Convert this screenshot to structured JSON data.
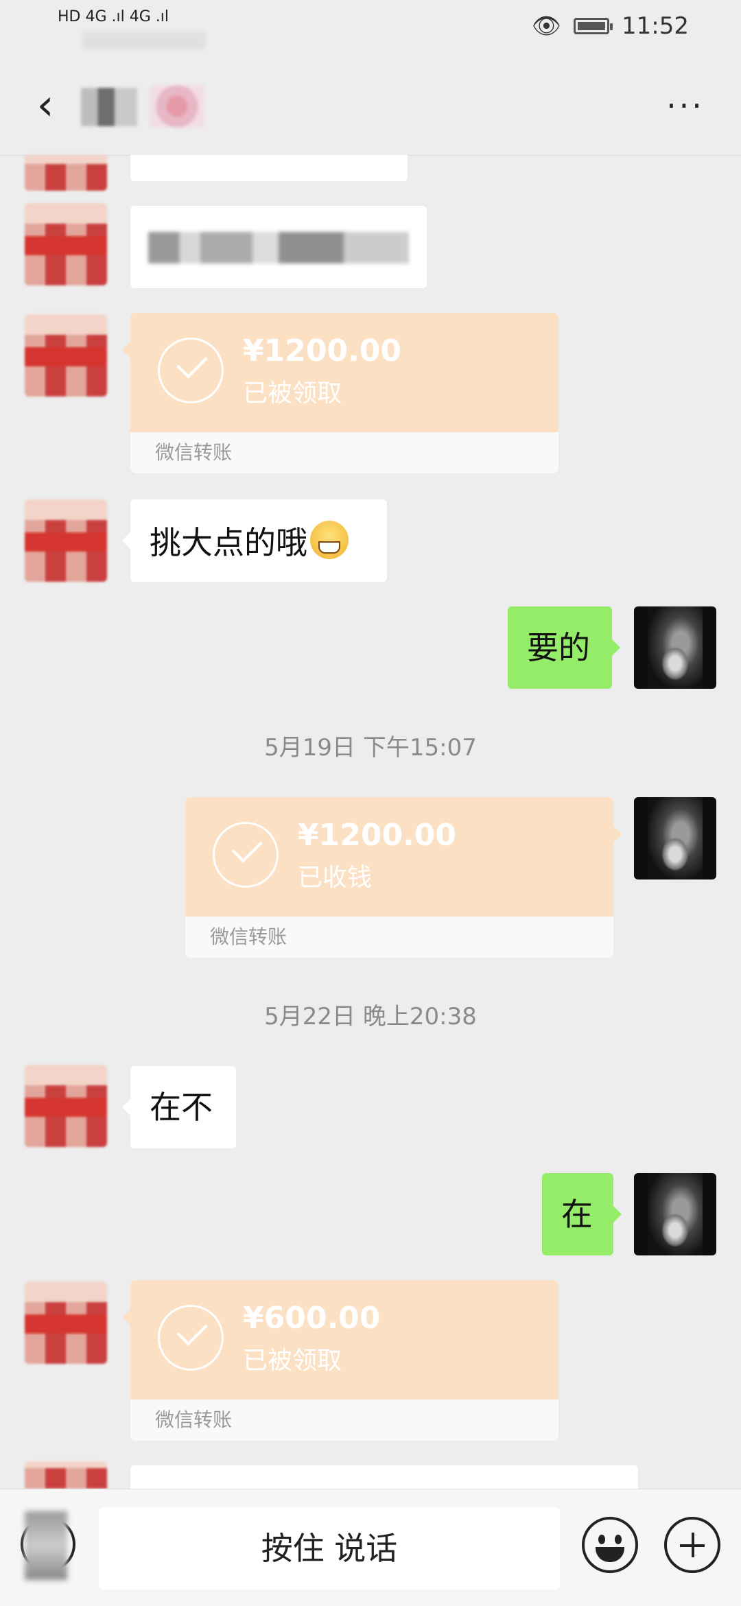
{
  "status_bar": {
    "network_left": "HD 4G .ıl 4G .ıl",
    "time": "11:52"
  },
  "header": {
    "back_icon": "chevron-left-icon",
    "more_label": "···"
  },
  "messages": [
    {
      "type": "text",
      "from": "other",
      "text": "挑大点的哦"
    },
    {
      "type": "text",
      "from": "me",
      "text": "要的"
    },
    {
      "type": "text",
      "from": "other",
      "text": "在不"
    },
    {
      "type": "text",
      "from": "me",
      "text": "在"
    }
  ],
  "transfers": [
    {
      "from": "other",
      "amount": "¥1200.00",
      "status": "已被领取",
      "label": "微信转账"
    },
    {
      "from": "me",
      "amount": "¥1200.00",
      "status": "已收钱",
      "label": "微信转账"
    },
    {
      "from": "other",
      "amount": "¥600.00",
      "status": "已被领取",
      "label": "微信转账"
    }
  ],
  "timestamps": [
    "5月19日 下午15:07",
    "5月22日 晚上20:38"
  ],
  "input_bar": {
    "hold_to_talk": "按住 说话",
    "voice_icon": "voice-icon",
    "emoji_icon": "smiley-icon",
    "plus_icon": "plus-icon"
  },
  "colors": {
    "background": "#ededed",
    "sent_bubble": "#95ec69",
    "received_bubble": "#ffffff",
    "transfer_card": "#fbe0c4"
  }
}
